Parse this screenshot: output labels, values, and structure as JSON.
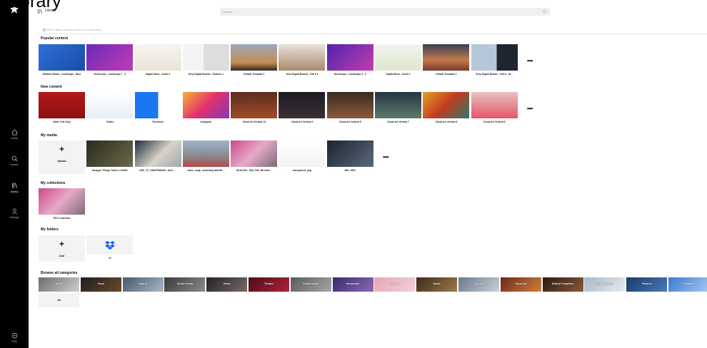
{
  "page": {
    "heading": "Library"
  },
  "sidebar": {
    "items": [
      {
        "label": "Home",
        "icon": "home-icon"
      },
      {
        "label": "Search",
        "icon": "search-icon"
      },
      {
        "label": "Library",
        "icon": "library-icon",
        "active": true
      },
      {
        "label": "Settings",
        "icon": "settings-icon"
      },
      {
        "label": "FAQ",
        "icon": "faq-icon"
      }
    ]
  },
  "topbar": {
    "title": "Library",
    "search_placeholder": "Search"
  },
  "hint": "Filter a library content to select it in a web action",
  "sections": {
    "popular": {
      "title": "Popular content",
      "items": [
        {
          "label": "Weather Board - Landscape - Blue",
          "bg": "linear-gradient(135deg,#2e6fd8,#1a4ca8)"
        },
        {
          "label": "Horoscope - Landscape 7 - 9",
          "bg": "linear-gradient(135deg,#6a2bb8,#c23ab5)"
        },
        {
          "label": "Digital Menu - Sushi 4",
          "bg": "linear-gradient(180deg,#f7f5ef,#e8e3d6)"
        },
        {
          "label": "Sexy Digital Boards - Fashion 1",
          "bg": "linear-gradient(90deg,#f4f4f4 45%,#ddd 45%)"
        },
        {
          "label": "Default Template 3",
          "bg": "linear-gradient(180deg,#9aa7b9,#c58c55 70%,#30291f)"
        },
        {
          "label": "Sexy Digital Boards - Fall 8 4",
          "bg": "linear-gradient(180deg,#e9e2da,#a88a6e)"
        },
        {
          "label": "Horoscope - Landscape 3 - 4",
          "bg": "linear-gradient(135deg,#4f25a8,#c33cb2)"
        },
        {
          "label": "Digital Menu - Sushi 1",
          "bg": "linear-gradient(180deg,#f3f4ee,#dde6cf)"
        },
        {
          "label": "Default Template 2",
          "bg": "linear-gradient(180deg,#3a3f55,#c47a4c 60%,#7b3b2a)"
        },
        {
          "label": "Sexy Digital Boards - Fall A - Gr...",
          "bg": "linear-gradient(90deg,#b7c7da 55%,#1f2530 55%)"
        }
      ]
    },
    "new": {
      "title": "New content",
      "items": [
        {
          "label": "News Text Only",
          "bg": "linear-gradient(180deg,#b01818,#8d1010)"
        },
        {
          "label": "Twitter",
          "bg": "linear-gradient(180deg,#ffffff,#e8eef4)"
        },
        {
          "label": "Facebook",
          "bg": "linear-gradient(90deg,#1977f2 50%,#ffffff 50%)"
        },
        {
          "label": "Instagram",
          "bg": "linear-gradient(135deg,#f9b233,#e1306c 50%,#833ab4)"
        },
        {
          "label": "Visual Art Vertical 10",
          "bg": "linear-gradient(180deg,#5a2d1d,#a34a2a)"
        },
        {
          "label": "Visual Art Vertical 9",
          "bg": "linear-gradient(180deg,#1c1a22,#3d3038)"
        },
        {
          "label": "Visual Art Vertical 8",
          "bg": "linear-gradient(180deg,#3a2a22,#8a5a3a)"
        },
        {
          "label": "Visual Art Vertical 7",
          "bg": "linear-gradient(180deg,#233544,#5d7a6a)"
        },
        {
          "label": "Visual Art Vertical 6",
          "bg": "linear-gradient(135deg,#e3a12a,#c23a1f 50%,#2b7a6a)"
        },
        {
          "label": "Visual Art Vertical 3",
          "bg": "linear-gradient(180deg,#e9c2c2,#e45468)"
        }
      ]
    },
    "media": {
      "title": "My media",
      "upload_label": "Upload",
      "items": [
        {
          "label": "Stranger Things Trailer 1 Netflix",
          "bg": "linear-gradient(135deg,#2a2a1e,#6b6a4a)"
        },
        {
          "label": "1500_TC_GRAFFIMANO_16x9 - ...",
          "bg": "linear-gradient(135deg,#1b2a3a,#d8d4c6 55%,#9aa6ae)"
        },
        {
          "label": "video_recap_marketing fat1036 ...",
          "bg": "linear-gradient(180deg,#9fb3c8,#8a8d92 55%,#b04a4a)"
        },
        {
          "label": "BL621501_TAM_GEI_MILANO...",
          "bg": "linear-gradient(135deg,#c94a8a,#e7a9c7 50%,#7b6a7a)"
        },
        {
          "label": "transparent_png",
          "bg": "linear-gradient(180deg,#ffffff,#f2f2f2)"
        },
        {
          "label": "IMG_9051",
          "bg": "linear-gradient(135deg,#1c2330,#5a6a7a)"
        }
      ]
    },
    "collections": {
      "title": "My collections",
      "items": [
        {
          "label": "GFO Collection",
          "bg": "linear-gradient(135deg,#c94a8a,#e7a9c7 50%,#7b6a7a)"
        }
      ]
    },
    "folders": {
      "title": "My folders",
      "add_label": "Add",
      "items": [
        {
          "label": "12"
        }
      ]
    },
    "categories": {
      "title": "Browse all categories",
      "items": [
        {
          "label": "Anim",
          "bg": "linear-gradient(135deg,#6b6b6b,#cfcfcf)"
        },
        {
          "label": "Food",
          "bg": "linear-gradient(135deg,#1e1e1e,#6a4a2a)"
        },
        {
          "label": "Sports",
          "bg": "linear-gradient(135deg,#465a6a,#a9b8c8)"
        },
        {
          "label": "Social media",
          "bg": "linear-gradient(135deg,#3a3a3a,#8a8a8a)"
        },
        {
          "label": "News",
          "bg": "linear-gradient(135deg,#222,#7a6a6a)"
        },
        {
          "label": "Theater",
          "bg": "linear-gradient(135deg,#4a0f15,#b0203a)"
        },
        {
          "label": "Social media",
          "bg": "linear-gradient(135deg,#5a5a5a,#a7a7a7)"
        },
        {
          "label": "Horoscope",
          "bg": "linear-gradient(135deg,#3a2a6a,#8a6ab8)"
        },
        {
          "label": "Fashion",
          "bg": "linear-gradient(135deg,#e7a5b5,#f3d0d8)"
        },
        {
          "label": "Music",
          "bg": "linear-gradient(135deg,#3a2a1a,#a07a4a)"
        },
        {
          "label": "Quotes",
          "bg": "linear-gradient(135deg,#6a7a8a,#c8d0d8)"
        },
        {
          "label": "Visual art",
          "bg": "linear-gradient(135deg,#6a2a1a,#d0803a)"
        },
        {
          "label": "Default Templates",
          "bg": "linear-gradient(135deg,#2a1a10,#8a5a3a)"
        },
        {
          "label": "Digital menus",
          "bg": "linear-gradient(135deg,#a8b8c8,#e8ecef)"
        },
        {
          "label": "Finance",
          "bg": "linear-gradient(135deg,#1a3a6a,#4a7ab8)"
        },
        {
          "label": "Weather",
          "bg": "linear-gradient(135deg,#3a7ad0,#a8c8f0)"
        }
      ],
      "all_label": "All"
    }
  },
  "more_label": "•••",
  "colors": {
    "sidebar": "#000000",
    "dropbox": "#0061ff"
  }
}
